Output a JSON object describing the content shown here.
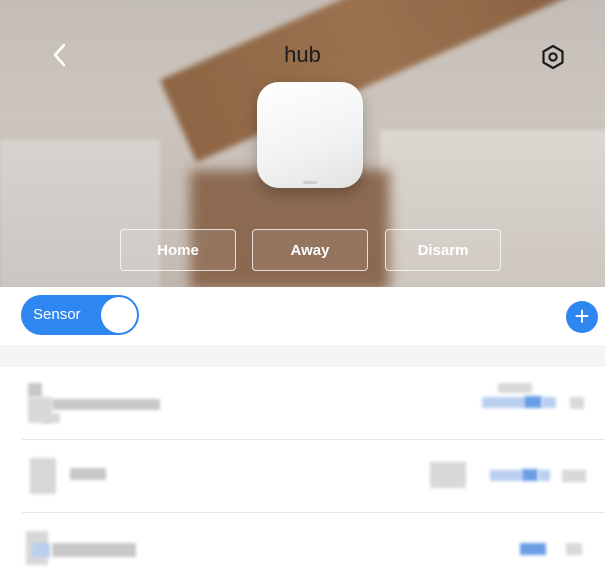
{
  "header": {
    "title": "hub",
    "back_icon": "chevron-left-icon",
    "settings_icon": "settings-gear-icon"
  },
  "modes": {
    "home_label": "Home",
    "away_label": "Away",
    "disarm_label": "Disarm"
  },
  "toolbar": {
    "toggle_label": "Sensor",
    "toggle_on": true,
    "add_label": "+",
    "accent_color": "#2e86f0"
  },
  "devices": [
    {
      "id": "row1"
    },
    {
      "id": "row2"
    },
    {
      "id": "row3"
    }
  ]
}
